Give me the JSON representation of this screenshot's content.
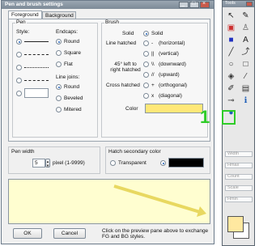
{
  "dialog": {
    "title": "Pen and brush settings",
    "tabs": [
      "Foreground",
      "Background"
    ],
    "pen": {
      "group": "Pen",
      "style_label": "Style:",
      "endcaps_label": "Endcaps:",
      "endcaps": [
        "Round",
        "Square",
        "Flat"
      ],
      "linejoins_label": "Line joins:",
      "linejoins": [
        "Round",
        "Beveled",
        "Mitered"
      ]
    },
    "brush": {
      "group": "Brush",
      "solid_left": "Solid",
      "solid_right": "Solid",
      "line_hatched": "Line hatched",
      "diag_hatched": "45° left to right hatched",
      "cross_hatched": "Cross hatched",
      "hatches": [
        "(horizontal)",
        "(vertical)",
        "(downward)",
        "(upward)",
        "(orthogonal)",
        "(diagonal)"
      ],
      "hatch_prefixes": [
        "-",
        "||",
        "\\\\",
        "//",
        "+",
        "x"
      ],
      "color_label": "Color",
      "color_value": "#ffe878"
    },
    "pen_width": {
      "label": "Pen width",
      "value": "5",
      "hint": "pixel (1-9999)"
    },
    "hatch": {
      "label": "Hatch secondary color",
      "transparent": "Transparent",
      "color_value": "#000000"
    },
    "preview_arrow_color": "#e8d860",
    "ok_label": "OK",
    "cancel_label": "Cancel",
    "help_text": "Click on the preview pane above to exchange FG and BG styles."
  },
  "palette": {
    "title": "Tools",
    "step_number": "1",
    "fields": [
      "Width",
      "Hmax",
      "Count",
      "Scale",
      "Hmin"
    ],
    "swatch_front": "#ffe8a0",
    "swatch_back": "#ffffff",
    "tools": [
      {
        "name": "arrow-icon",
        "glyph": "↖",
        "color": "#222"
      },
      {
        "name": "pencil-icon",
        "glyph": "✎",
        "color": "#222"
      },
      {
        "name": "red-layer-icon",
        "glyph": "▣",
        "color": "#cc3030"
      },
      {
        "name": "stamp-icon",
        "glyph": "♙",
        "color": "#555"
      },
      {
        "name": "blue-shape-icon",
        "glyph": "■",
        "color": "#2030c0"
      },
      {
        "name": "text-icon",
        "glyph": "A",
        "color": "#222"
      },
      {
        "name": "line-icon",
        "glyph": "╱",
        "color": "#333"
      },
      {
        "name": "curve-icon",
        "glyph": "⤴",
        "color": "#333"
      },
      {
        "name": "ellipse-icon",
        "glyph": "○",
        "color": "#333"
      },
      {
        "name": "rectangle-icon",
        "glyph": "□",
        "color": "#333"
      },
      {
        "name": "fill-icon",
        "glyph": "◈",
        "color": "#333"
      },
      {
        "name": "brush-icon",
        "glyph": "⁄",
        "color": "#333"
      },
      {
        "name": "pen-brush-settings-icon",
        "glyph": "✐",
        "color": "#222"
      },
      {
        "name": "grid-icon",
        "glyph": "▤",
        "color": "#333"
      },
      {
        "name": "eyedropper-icon",
        "glyph": "⊸",
        "color": "#333"
      },
      {
        "name": "info-icon",
        "glyph": "ℹ",
        "color": "#1f5fb8"
      },
      {
        "name": "help-icon",
        "glyph": "●",
        "color": "#1f5fb8"
      }
    ]
  }
}
